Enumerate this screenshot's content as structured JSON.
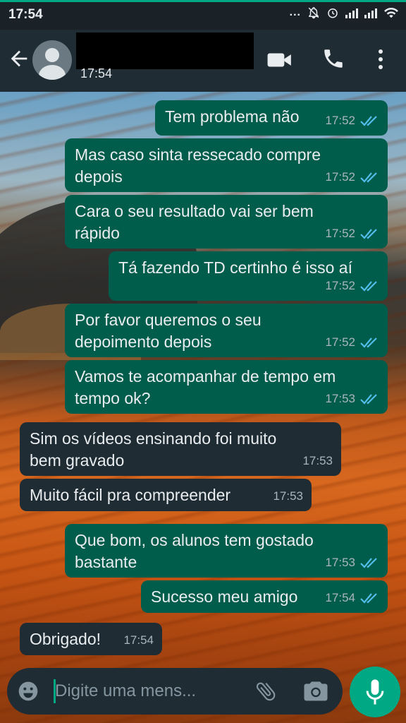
{
  "status_bar": {
    "time": "17:54",
    "dots": "..."
  },
  "header": {
    "last_seen": "17:54"
  },
  "colors": {
    "accent": "#00a884",
    "outgoing_bubble": "#005c4b",
    "incoming_bubble": "#1f2c34",
    "header_bg": "#1f2c34",
    "tick_blue": "#53bdeb"
  },
  "icons": [
    "back-arrow-icon",
    "avatar",
    "video-call-icon",
    "voice-call-icon",
    "more-options-icon",
    "emoji-icon",
    "attach-icon",
    "camera-icon",
    "mic-icon",
    "double-check-icon"
  ],
  "messages": [
    {
      "dir": "out",
      "text": "Tem problema não",
      "time": "17:52",
      "read": true
    },
    {
      "dir": "out",
      "text": "Mas caso sinta ressecado compre depois",
      "time": "17:52",
      "read": true
    },
    {
      "dir": "out",
      "text": "Cara o seu resultado vai ser bem rápido",
      "time": "17:52",
      "read": true
    },
    {
      "dir": "out",
      "text": "Tá fazendo TD certinho é isso aí",
      "time": "17:52",
      "read": true
    },
    {
      "dir": "out",
      "text": "Por favor queremos o seu depoimento depois",
      "time": "17:52",
      "read": true
    },
    {
      "dir": "out",
      "text": "Vamos te acompanhar de tempo em tempo ok?",
      "time": "17:53",
      "read": true
    },
    {
      "dir": "in",
      "text": "Sim os vídeos ensinando foi muito bem gravado",
      "time": "17:53"
    },
    {
      "dir": "in",
      "text": "Muito fácil pra compreender",
      "time": "17:53"
    },
    {
      "dir": "out",
      "text": "Que bom, os alunos tem gostado bastante",
      "time": "17:53",
      "read": true
    },
    {
      "dir": "out",
      "text": "Sucesso meu amigo",
      "time": "17:54",
      "read": true
    },
    {
      "dir": "in",
      "text": "Obrigado!",
      "time": "17:54"
    }
  ],
  "composer": {
    "placeholder": "Digite uma mens..."
  }
}
